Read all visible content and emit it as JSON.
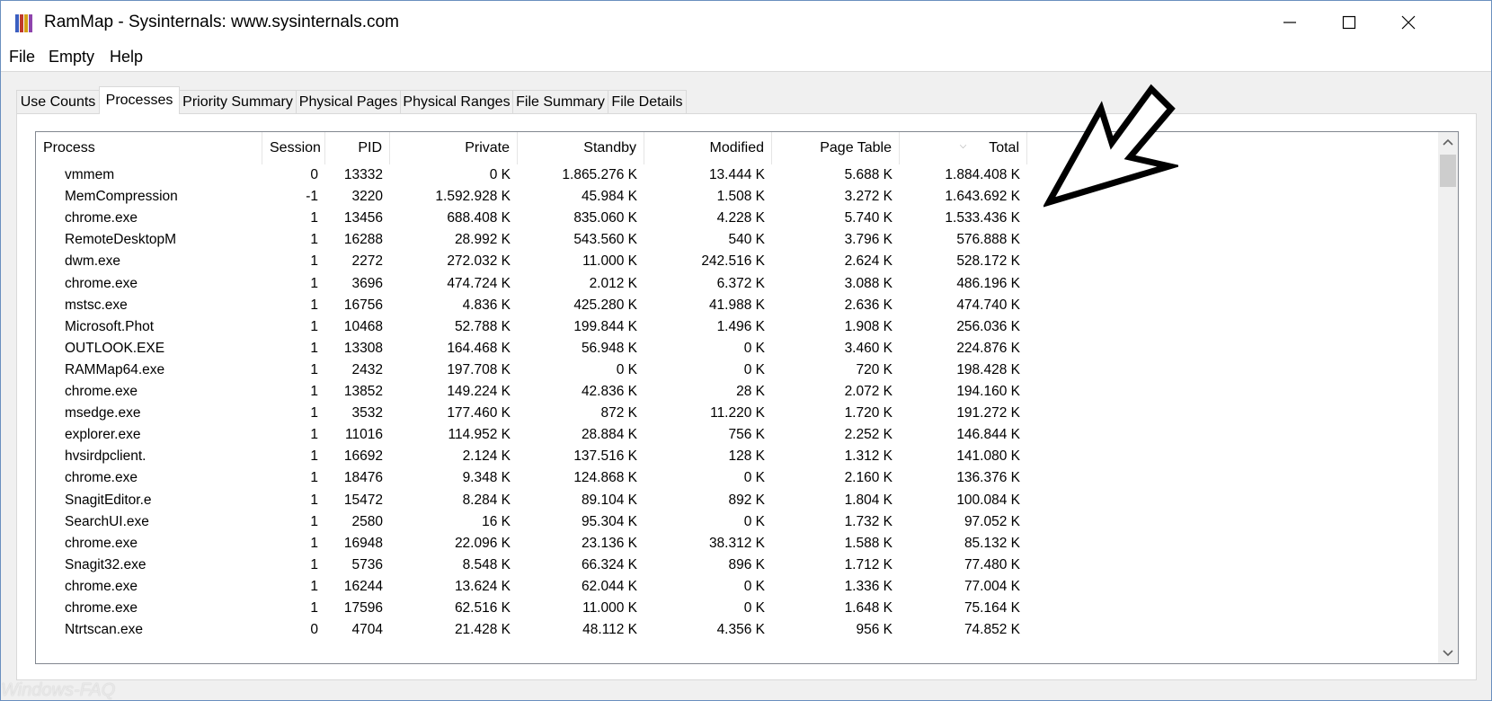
{
  "window": {
    "title": "RamMap - Sysinternals: www.sysinternals.com",
    "controls": {
      "minimize": "minimize-icon",
      "maximize": "maximize-icon",
      "close": "close-icon"
    }
  },
  "menu": [
    "File",
    "Empty",
    "Help"
  ],
  "tabs": [
    {
      "label": "Use Counts",
      "active": false
    },
    {
      "label": "Processes",
      "active": true
    },
    {
      "label": "Priority Summary",
      "active": false
    },
    {
      "label": "Physical Pages",
      "active": false
    },
    {
      "label": "Physical Ranges",
      "active": false
    },
    {
      "label": "File Summary",
      "active": false
    },
    {
      "label": "File Details",
      "active": false
    }
  ],
  "table": {
    "columns": [
      "Process",
      "Session",
      "PID",
      "Private",
      "Standby",
      "Modified",
      "Page Table",
      "Total"
    ],
    "sorted_column": "Total",
    "rows": [
      [
        "vmmem",
        "0",
        "13332",
        "0 K",
        "1.865.276 K",
        "13.444 K",
        "5.688 K",
        "1.884.408 K"
      ],
      [
        "MemCompression",
        "-1",
        "3220",
        "1.592.928 K",
        "45.984 K",
        "1.508 K",
        "3.272 K",
        "1.643.692 K"
      ],
      [
        "chrome.exe",
        "1",
        "13456",
        "688.408 K",
        "835.060 K",
        "4.228 K",
        "5.740 K",
        "1.533.436 K"
      ],
      [
        "RemoteDesktopM",
        "1",
        "16288",
        "28.992 K",
        "543.560 K",
        "540 K",
        "3.796 K",
        "576.888 K"
      ],
      [
        "dwm.exe",
        "1",
        "2272",
        "272.032 K",
        "11.000 K",
        "242.516 K",
        "2.624 K",
        "528.172 K"
      ],
      [
        "chrome.exe",
        "1",
        "3696",
        "474.724 K",
        "2.012 K",
        "6.372 K",
        "3.088 K",
        "486.196 K"
      ],
      [
        "mstsc.exe",
        "1",
        "16756",
        "4.836 K",
        "425.280 K",
        "41.988 K",
        "2.636 K",
        "474.740 K"
      ],
      [
        "Microsoft.Phot",
        "1",
        "10468",
        "52.788 K",
        "199.844 K",
        "1.496 K",
        "1.908 K",
        "256.036 K"
      ],
      [
        "OUTLOOK.EXE",
        "1",
        "13308",
        "164.468 K",
        "56.948 K",
        "0 K",
        "3.460 K",
        "224.876 K"
      ],
      [
        "RAMMap64.exe",
        "1",
        "2432",
        "197.708 K",
        "0 K",
        "0 K",
        "720 K",
        "198.428 K"
      ],
      [
        "chrome.exe",
        "1",
        "13852",
        "149.224 K",
        "42.836 K",
        "28 K",
        "2.072 K",
        "194.160 K"
      ],
      [
        "msedge.exe",
        "1",
        "3532",
        "177.460 K",
        "872 K",
        "11.220 K",
        "1.720 K",
        "191.272 K"
      ],
      [
        "explorer.exe",
        "1",
        "11016",
        "114.952 K",
        "28.884 K",
        "756 K",
        "2.252 K",
        "146.844 K"
      ],
      [
        "hvsirdpclient.",
        "1",
        "16692",
        "2.124 K",
        "137.516 K",
        "128 K",
        "1.312 K",
        "141.080 K"
      ],
      [
        "chrome.exe",
        "1",
        "18476",
        "9.348 K",
        "124.868 K",
        "0 K",
        "2.160 K",
        "136.376 K"
      ],
      [
        "SnagitEditor.e",
        "1",
        "15472",
        "8.284 K",
        "89.104 K",
        "892 K",
        "1.804 K",
        "100.084 K"
      ],
      [
        "SearchUI.exe",
        "1",
        "2580",
        "16 K",
        "95.304 K",
        "0 K",
        "1.732 K",
        "97.052 K"
      ],
      [
        "chrome.exe",
        "1",
        "16948",
        "22.096 K",
        "23.136 K",
        "38.312 K",
        "1.588 K",
        "85.132 K"
      ],
      [
        "Snagit32.exe",
        "1",
        "5736",
        "8.548 K",
        "66.324 K",
        "896 K",
        "1.712 K",
        "77.480 K"
      ],
      [
        "chrome.exe",
        "1",
        "16244",
        "13.624 K",
        "62.044 K",
        "0 K",
        "1.336 K",
        "77.004 K"
      ],
      [
        "chrome.exe",
        "1",
        "17596",
        "62.516 K",
        "11.000 K",
        "0 K",
        "1.648 K",
        "75.164 K"
      ],
      [
        "Ntrtscan.exe",
        "0",
        "4704",
        "21.428 K",
        "48.112 K",
        "4.356 K",
        "956 K",
        "74.852 K"
      ]
    ]
  },
  "watermark": "Windows-FAQ",
  "colors": {
    "window_border": "#6a8fbf",
    "chrome_bg": "#f0f0f0"
  }
}
